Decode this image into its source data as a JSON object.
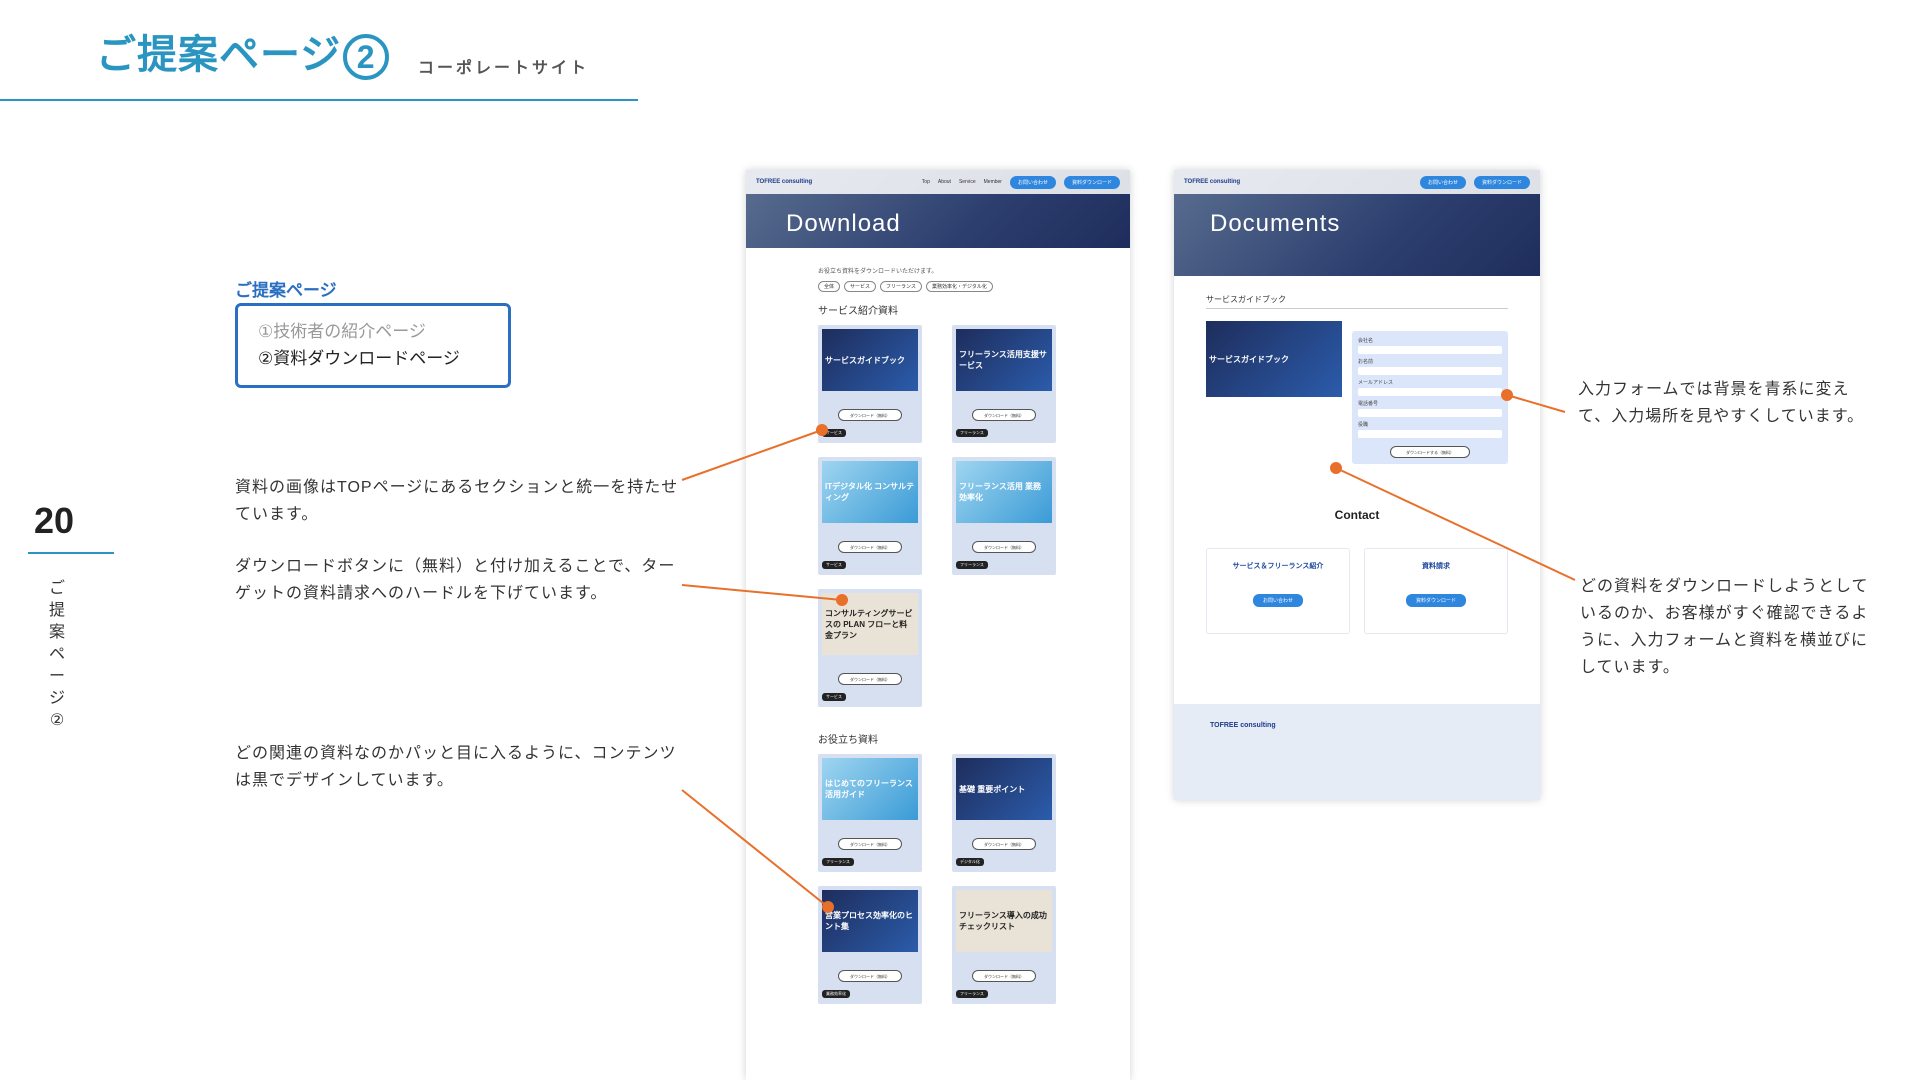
{
  "header": {
    "title": "ご提案ページ",
    "title_num": "2",
    "subtitle": "コーポレートサイト"
  },
  "page_number": "20",
  "side_label": "ご提案ページ②",
  "selector": {
    "label": "ご提案ページ",
    "option1": "①技術者の紹介ページ",
    "option2": "②資料ダウンロードページ"
  },
  "notes": {
    "n1": "資料の画像はTOPページにあるセクションと統一を持たせています。",
    "n2": "ダウンロードボタンに（無料）と付け加えることで、ターゲットの資料請求へのハードルを下げています。",
    "n3": "どの関連の資料なのかパッと目に入るように、コンテンツは黒でデザインしています。",
    "n4": "入力フォームでは背景を青系に変えて、入力場所を見やすくしています。",
    "n5": "どの資料をダウンロードしようとしているのか、お客様がすぐ確認できるように、入力フォームと資料を横並びにしています。"
  },
  "colors": {
    "accent": "#2b95c2",
    "arrow": "#e8702a",
    "selector": "#2b6fc2"
  },
  "mock1": {
    "nav": {
      "logo": "TOFREE consulting",
      "items": [
        "Top",
        "About",
        "Service",
        "Member"
      ],
      "btn1": "お問い合わせ",
      "btn2": "資料ダウンロード"
    },
    "hero": "Download",
    "intro": "お役立ち資料をダウンロードいただけます。",
    "tags": [
      "全体",
      "サービス",
      "フリーランス",
      "業務効率化・デジタル化"
    ],
    "section1": "サービス紹介資料",
    "cards1": [
      {
        "title": "サービスガイドブック",
        "btn": "ダウンロード（無料）",
        "tag": "サービス"
      },
      {
        "title": "フリーランス活用支援サービス",
        "btn": "ダウンロード（無料）",
        "tag": "フリーランス"
      },
      {
        "title": "ITデジタル化 コンサルティング",
        "btn": "ダウンロード（無料）",
        "tag": "サービス"
      },
      {
        "title": "フリーランス活用 業務効率化",
        "btn": "ダウンロード（無料）",
        "tag": "フリーランス"
      },
      {
        "title": "コンサルティングサービスの PLAN フローと料金プラン",
        "btn": "ダウンロード（無料）",
        "tag": "サービス"
      }
    ],
    "section2": "お役立ち資料",
    "cards2": [
      {
        "title": "はじめてのフリーランス活用ガイド",
        "btn": "ダウンロード（無料）",
        "tag": "フリーランス"
      },
      {
        "title": "基礎 重要ポイント",
        "btn": "ダウンロード（無料）",
        "tag": "デジタル化"
      },
      {
        "title": "営業プロセス効率化のヒント集",
        "btn": "ダウンロード（無料）",
        "tag": "業務効率化"
      },
      {
        "title": "フリーランス導入の成功チェックリスト",
        "btn": "ダウンロード（無料）",
        "tag": "フリーランス"
      }
    ]
  },
  "mock2": {
    "nav": {
      "logo": "TOFREE consulting",
      "btn1": "お問い合わせ",
      "btn2": "資料ダウンロード"
    },
    "hero": "Documents",
    "section": "サービスガイドブック",
    "doc_title": "サービスガイドブック",
    "fields": [
      "会社名",
      "お名前",
      "メールアドレス",
      "電話番号",
      "役職"
    ],
    "submit": "ダウンロードする（無料）",
    "contact_title": "Contact",
    "box1": {
      "title": "サービス＆フリーランス紹介",
      "btn": "お問い合わせ"
    },
    "box2": {
      "title": "資料請求",
      "btn": "資料ダウンロード"
    },
    "footer_logo": "TOFREE consulting"
  }
}
